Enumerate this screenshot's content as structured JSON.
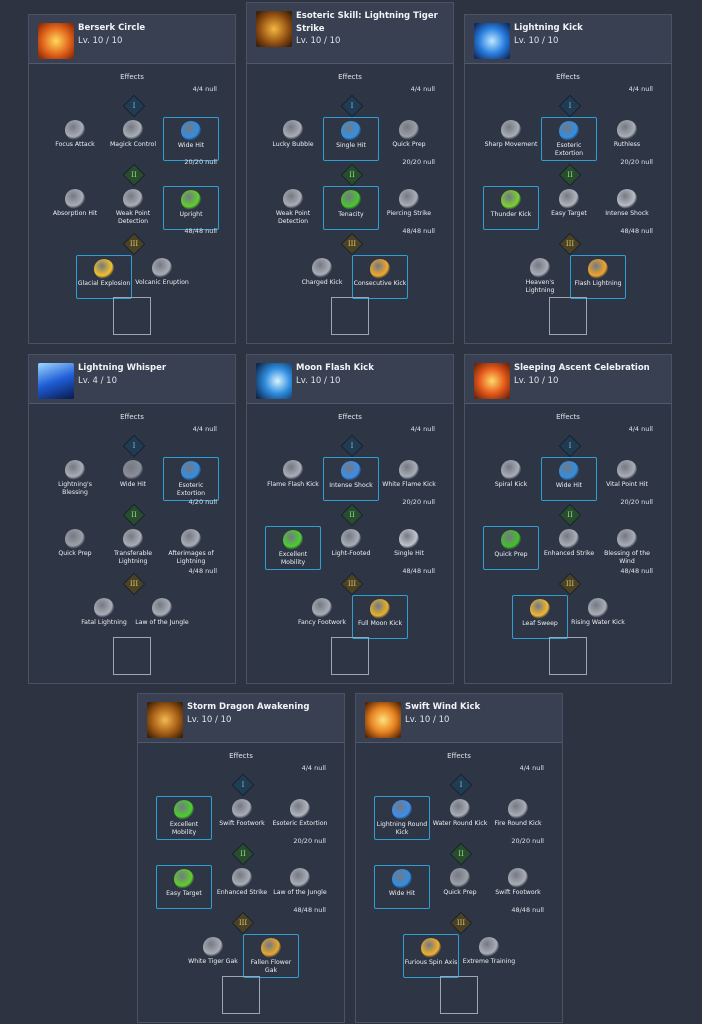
{
  "effects_label": "Effects",
  "tier_labels": [
    "I",
    "II",
    "III"
  ],
  "colors": {
    "background": "#2d3340",
    "selected_border": "#2f9fd3",
    "card_bg": "#2e3544"
  },
  "cards": [
    {
      "name": "Berserk Circle",
      "level": "Lv.   10 / 10",
      "icon": "fire-burst-icon",
      "tiers": [
        {
          "count": "4/4 null",
          "nodes": [
            {
              "label": "Focus Attack",
              "icon": "focus-attack-icon"
            },
            {
              "label": "Magick Control",
              "icon": "magick-control-icon"
            },
            {
              "label": "Wide Hit",
              "icon": "wide-hit-icon",
              "selected": true
            }
          ]
        },
        {
          "count": "20/20 null",
          "nodes": [
            {
              "label": "Absorption Hit",
              "icon": "absorption-hit-icon"
            },
            {
              "label": "Weak Point Detection",
              "icon": "weak-point-icon"
            },
            {
              "label": "Upright",
              "icon": "upright-icon",
              "selected": true
            }
          ]
        },
        {
          "count": "48/48 null",
          "nodes": [
            {
              "label": "Glacial Explosion",
              "icon": "glacial-explosion-icon",
              "selected": true
            },
            {
              "label": "Volcanic Eruption",
              "icon": "volcanic-eruption-icon"
            }
          ]
        }
      ]
    },
    {
      "name": "Esoteric Skill: Lightning Tiger Strike",
      "level": "Lv.   10 / 10",
      "icon": "tiger-icon",
      "tiers": [
        {
          "count": "4/4 null",
          "nodes": [
            {
              "label": "Lucky Bubble",
              "icon": "lucky-bubble-icon"
            },
            {
              "label": "Single Hit",
              "icon": "single-hit-icon",
              "selected": true
            },
            {
              "label": "Quick Prep",
              "icon": "quick-prep-icon"
            }
          ]
        },
        {
          "count": "20/20 null",
          "nodes": [
            {
              "label": "Weak Point Detection",
              "icon": "weak-point-icon"
            },
            {
              "label": "Tenacity",
              "icon": "tenacity-icon",
              "selected": true
            },
            {
              "label": "Piercing Strike",
              "icon": "piercing-strike-icon"
            }
          ]
        },
        {
          "count": "48/48 null",
          "nodes": [
            {
              "label": "Charged Kick",
              "icon": "charged-kick-icon"
            },
            {
              "label": "Consecutive Kick",
              "icon": "consecutive-kick-icon",
              "selected": true
            }
          ]
        }
      ]
    },
    {
      "name": "Lightning Kick",
      "level": "Lv.   10 / 10",
      "icon": "lightning-icon",
      "tiers": [
        {
          "count": "4/4 null",
          "nodes": [
            {
              "label": "Sharp Movement",
              "icon": "sharp-movement-icon"
            },
            {
              "label": "Esoteric Extortion",
              "icon": "esoteric-extortion-icon",
              "selected": true
            },
            {
              "label": "Ruthless",
              "icon": "ruthless-icon"
            }
          ]
        },
        {
          "count": "20/20 null",
          "nodes": [
            {
              "label": "Thunder Kick",
              "icon": "thunder-kick-icon",
              "selected": true
            },
            {
              "label": "Easy Target",
              "icon": "easy-target-icon"
            },
            {
              "label": "Intense Shock",
              "icon": "intense-shock-icon"
            }
          ]
        },
        {
          "count": "48/48 null",
          "nodes": [
            {
              "label": "Heaven's Lightning",
              "icon": "heavens-lightning-icon"
            },
            {
              "label": "Flash Lightning",
              "icon": "flash-lightning-icon",
              "selected": true
            }
          ]
        }
      ]
    },
    {
      "name": "Lightning Whisper",
      "level": "Lv.   4 / 10",
      "icon": "lightning-whisper-icon",
      "tiers": [
        {
          "count": "4/4 null",
          "nodes": [
            {
              "label": "Lightning's Blessing",
              "icon": "lightning-blessing-icon"
            },
            {
              "label": "Wide Hit",
              "icon": "wide-hit-icon"
            },
            {
              "label": "Esoteric Extortion",
              "icon": "esoteric-extortion-icon",
              "selected": true
            }
          ]
        },
        {
          "count": "4/20 null",
          "nodes": [
            {
              "label": "Quick Prep",
              "icon": "quick-prep-icon"
            },
            {
              "label": "Transferable Lightning",
              "icon": "transferable-lightning-icon"
            },
            {
              "label": "Afterimages of Lightning",
              "icon": "afterimages-icon"
            }
          ]
        },
        {
          "count": "4/48 null",
          "nodes": [
            {
              "label": "Fatal Lightning",
              "icon": "fatal-lightning-icon"
            },
            {
              "label": "Law of the Jungle",
              "icon": "skull-icon"
            }
          ]
        }
      ]
    },
    {
      "name": "Moon Flash Kick",
      "level": "Lv.   10 / 10",
      "icon": "moon-flash-icon",
      "tiers": [
        {
          "count": "4/4 null",
          "nodes": [
            {
              "label": "Flame Flash Kick",
              "icon": "flame-flash-icon"
            },
            {
              "label": "Intense Shock",
              "icon": "intense-shock-icon",
              "selected": true
            },
            {
              "label": "White Flame Kick",
              "icon": "white-flame-icon"
            }
          ]
        },
        {
          "count": "20/20 null",
          "nodes": [
            {
              "label": "Excellent Mobility",
              "icon": "excellent-mobility-icon",
              "selected": true
            },
            {
              "label": "Light-Footed",
              "icon": "light-footed-icon"
            },
            {
              "label": "Single Hit",
              "icon": "single-hit-icon"
            }
          ]
        },
        {
          "count": "48/48 null",
          "nodes": [
            {
              "label": "Fancy Footwork",
              "icon": "fancy-footwork-icon"
            },
            {
              "label": "Full Moon Kick",
              "icon": "full-moon-kick-icon",
              "selected": true
            }
          ]
        }
      ]
    },
    {
      "name": "Sleeping Ascent Celebration",
      "level": "Lv.   10 / 10",
      "icon": "spiral-fire-icon",
      "tiers": [
        {
          "count": "4/4 null",
          "nodes": [
            {
              "label": "Spiral Kick",
              "icon": "spiral-kick-icon"
            },
            {
              "label": "Wide Hit",
              "icon": "wide-hit-icon",
              "selected": true
            },
            {
              "label": "Vital Point Hit",
              "icon": "vital-point-icon"
            }
          ]
        },
        {
          "count": "20/20 null",
          "nodes": [
            {
              "label": "Quick Prep",
              "icon": "quick-prep-icon",
              "selected": true
            },
            {
              "label": "Enhanced Strike",
              "icon": "enhanced-strike-icon"
            },
            {
              "label": "Blessing of the Wind",
              "icon": "wind-blessing-icon"
            }
          ]
        },
        {
          "count": "48/48 null",
          "nodes": [
            {
              "label": "Leaf Sweep",
              "icon": "leaf-sweep-icon",
              "selected": true
            },
            {
              "label": "Rising Water Kick",
              "icon": "rising-water-icon"
            }
          ]
        }
      ]
    },
    {
      "name": "Storm Dragon Awakening",
      "level": "Lv.   10 / 10",
      "icon": "storm-dragon-icon",
      "tiers": [
        {
          "count": "4/4 null",
          "nodes": [
            {
              "label": "Excellent Mobility",
              "icon": "excellent-mobility-icon",
              "selected": true
            },
            {
              "label": "Swift Footwork",
              "icon": "swift-footwork-icon"
            },
            {
              "label": "Esoteric Extortion",
              "icon": "esoteric-extortion-icon"
            }
          ]
        },
        {
          "count": "20/20 null",
          "nodes": [
            {
              "label": "Easy Target",
              "icon": "easy-target-icon",
              "selected": true
            },
            {
              "label": "Enhanced Strike",
              "icon": "enhanced-strike-icon"
            },
            {
              "label": "Law of the Jungle",
              "icon": "skull-icon"
            }
          ]
        },
        {
          "count": "48/48 null",
          "nodes": [
            {
              "label": "White Tiger Gak",
              "icon": "white-tiger-icon"
            },
            {
              "label": "Fallen Flower Gak",
              "icon": "fallen-flower-icon",
              "selected": true
            }
          ]
        }
      ]
    },
    {
      "name": "Swift Wind Kick",
      "level": "Lv.   10 / 10",
      "icon": "swift-wind-icon",
      "tiers": [
        {
          "count": "4/4 null",
          "nodes": [
            {
              "label": "Lightning Round Kick",
              "icon": "lightning-round-icon",
              "selected": true
            },
            {
              "label": "Water Round Kick",
              "icon": "water-round-icon"
            },
            {
              "label": "Fire Round Kick",
              "icon": "fire-round-icon"
            }
          ]
        },
        {
          "count": "20/20 null",
          "nodes": [
            {
              "label": "Wide Hit",
              "icon": "wide-hit-icon",
              "selected": true
            },
            {
              "label": "Quick Prep",
              "icon": "quick-prep-icon"
            },
            {
              "label": "Swift Footwork",
              "icon": "swift-footwork-icon"
            }
          ]
        },
        {
          "count": "48/48 null",
          "nodes": [
            {
              "label": "Furious Spin Axis",
              "icon": "furious-spin-icon",
              "selected": true
            },
            {
              "label": "Extreme Training",
              "icon": "extreme-training-icon"
            }
          ]
        }
      ]
    }
  ]
}
